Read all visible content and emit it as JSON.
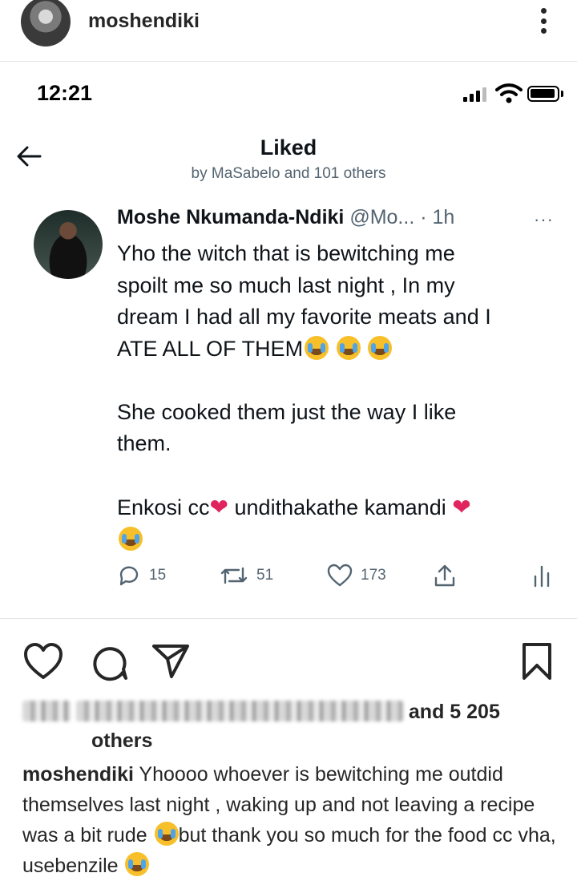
{
  "ig": {
    "username": "moshendiki",
    "more_icon": "more-vertical-icon"
  },
  "phone_status": {
    "time": "12:21"
  },
  "liked": {
    "title": "Liked",
    "subtitle": "by MaSabelo and 101 others"
  },
  "tweet": {
    "name": "Moshe Nkumanda-Ndiki",
    "handle": "@Mo...",
    "time": "· 1h",
    "more": "···",
    "line1": "Yho the witch that is bewitching me",
    "line2": "spoilt me so much last night , In my",
    "line3": "dream I had all my favorite meats and I",
    "line4": "ATE ALL OF THEM",
    "line5": "She cooked them just the way I like",
    "line6": "them.",
    "line7a": "Enkosi cc",
    "line7b": " undithakathe kamandi ",
    "heart": "❤",
    "replies": "15",
    "retweets": "51",
    "likes": "173"
  },
  "post": {
    "likes_prefix": "and 5 205",
    "likes_suffix": "others",
    "caption_user": "moshendiki",
    "caption_text1": " Yhoooo whoever is bewitching me outdid themselves last night , waking up and not leaving a recipe was a bit rude ",
    "caption_text2": "but thank you so much for the food cc vha, usebenzile "
  }
}
